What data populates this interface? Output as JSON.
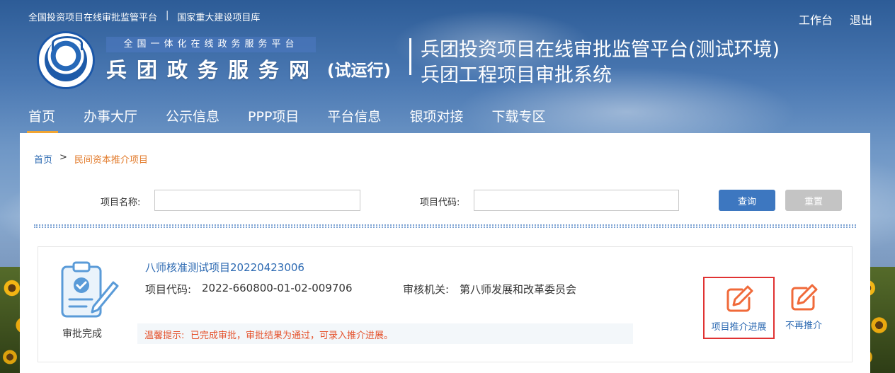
{
  "header": {
    "top_links": [
      "全国投资项目在线审批监管平台",
      "|",
      "国家重大建设项目库"
    ],
    "user_links": [
      "工作台",
      "退出"
    ],
    "brand_sub": "全国一体化在线政务服务平台",
    "brand_main": "兵团政务服务网",
    "brand_tag": "(试运行)",
    "sys_title1": "兵团投资项目在线审批监管平台(测试环境)",
    "sys_title2": "兵团工程项目审批系统"
  },
  "nav": {
    "items": [
      "首页",
      "办事大厅",
      "公示信息",
      "PPP项目",
      "平台信息",
      "银项对接",
      "下载专区"
    ],
    "active": "首页"
  },
  "breadcrumb": {
    "home": "首页",
    "arrow": ">",
    "current": "民间资本推介项目"
  },
  "search": {
    "name_label": "项目名称:",
    "name_value": "",
    "code_label": "项目代码:",
    "code_value": "",
    "query_label": "查询",
    "reset_label": "重置"
  },
  "project": {
    "status": "审批完成",
    "title": "八师核准测试项目20220423006",
    "code_label": "项目代码:",
    "code": "2022-660800-01-02-009706",
    "org_label": "审核机关:",
    "org": "第八师发展和改革委员会",
    "tip_label": "温馨提示:",
    "tip_text": "已完成审批，审批结果为通过，可录入推介进展。",
    "action_progress": "项目推介进展",
    "action_cancel": "不再推介"
  },
  "colors": {
    "accent_blue": "#2d6ab2",
    "button_blue": "#3d77c0",
    "nav_underline": "#f2a531",
    "tip_red": "#e5522c",
    "icon_orange": "#f06a3a",
    "highlight_border": "#e03232"
  }
}
